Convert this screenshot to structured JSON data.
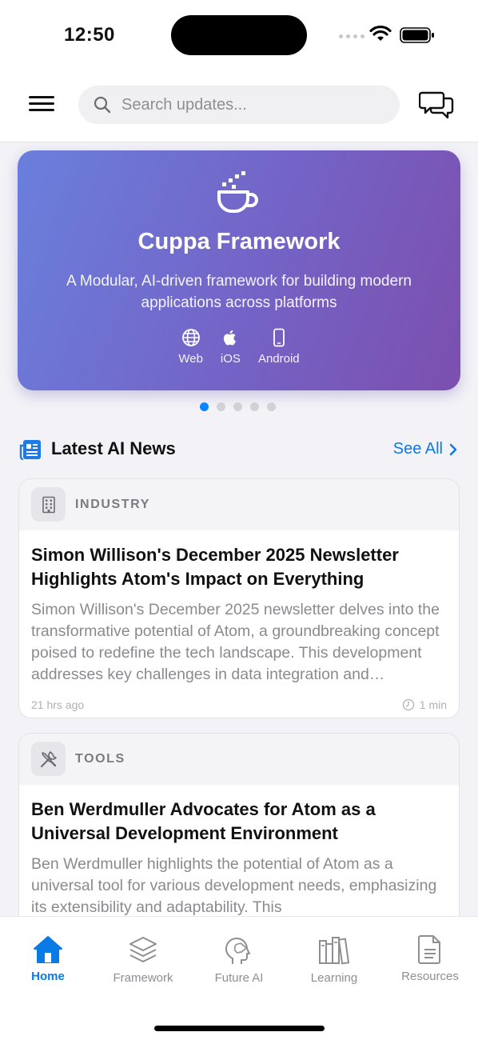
{
  "status_bar": {
    "time": "12:50"
  },
  "search": {
    "placeholder": "Search updates..."
  },
  "hero": {
    "title": "Cuppa Framework",
    "subtitle": "A Modular, AI-driven framework for building modern applications across platforms",
    "platforms": [
      {
        "label": "Web",
        "icon": "globe-icon"
      },
      {
        "label": "iOS",
        "icon": "apple-icon"
      },
      {
        "label": "Android",
        "icon": "phone-icon"
      }
    ],
    "pager_count": 5,
    "pager_active": 1
  },
  "section": {
    "title": "Latest AI News",
    "see_all": "See All"
  },
  "news": [
    {
      "category": "INDUSTRY",
      "icon": "building-icon",
      "title": "Simon Willison's December 2025 Newsletter Highlights Atom's Impact on Everything",
      "description": "Simon Willison's December 2025 newsletter delves into the transformative potential of Atom, a groundbreaking concept poised to redefine the tech landscape. This development addresses key challenges in data integration and interoperability.",
      "time": "21 hrs ago",
      "read_time": "1 min"
    },
    {
      "category": "TOOLS",
      "icon": "tools-icon",
      "title": "Ben Werdmuller Advocates for Atom as a Universal Development Environment",
      "description": "Ben Werdmuller highlights the potential of Atom as a universal tool for various development needs, emphasizing its extensibility and adaptability. This"
    }
  ],
  "tabs": [
    {
      "label": "Home",
      "icon": "home-icon",
      "active": true
    },
    {
      "label": "Framework",
      "icon": "layers-icon",
      "active": false
    },
    {
      "label": "Future AI",
      "icon": "brain-head-icon",
      "active": false
    },
    {
      "label": "Learning",
      "icon": "books-icon",
      "active": false
    },
    {
      "label": "Resources",
      "icon": "document-icon",
      "active": false
    }
  ],
  "colors": {
    "accent": "#0a7ae6",
    "hero_start": "#6a7fdc",
    "hero_end": "#7c4fae"
  }
}
